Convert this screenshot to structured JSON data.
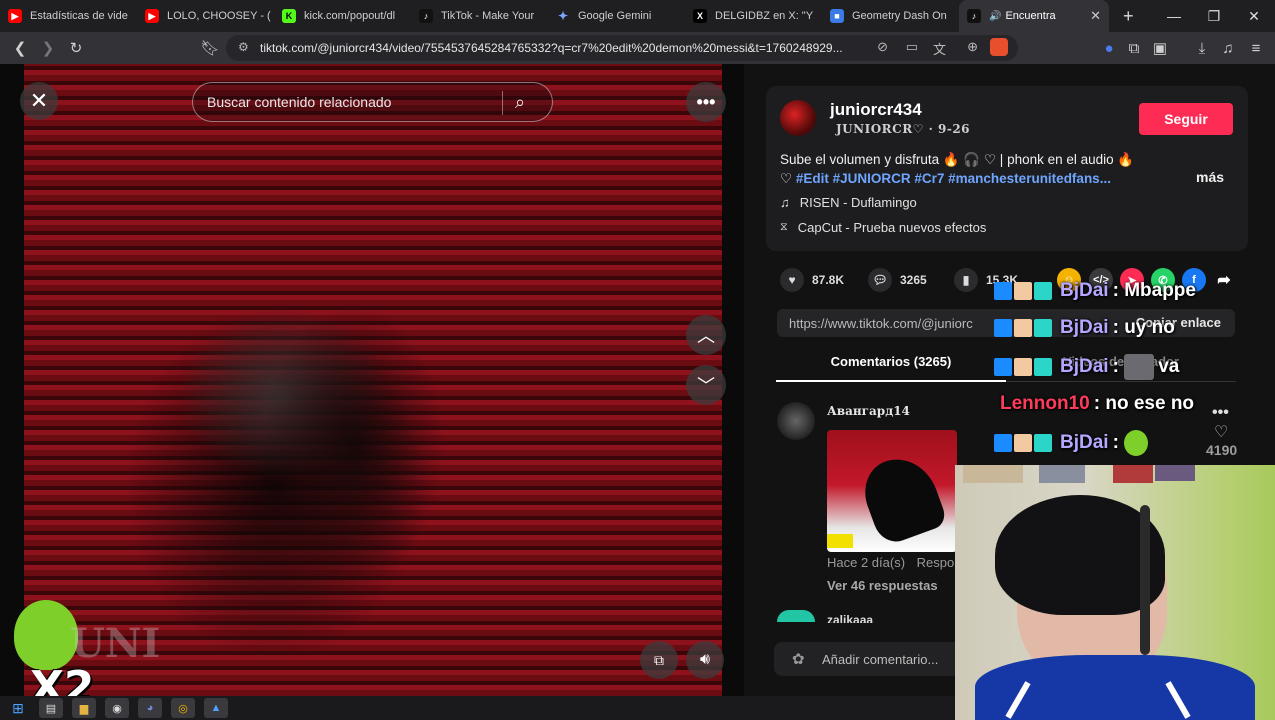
{
  "tabs": [
    {
      "title": "Estadísticas de vide",
      "color": "#ff0000",
      "glyph": "▶"
    },
    {
      "title": "LOLO, CHOOSEY - (",
      "color": "#ff0000",
      "glyph": "▶"
    },
    {
      "title": "kick.com/popout/dl",
      "color": "#53fc18",
      "glyph": "K"
    },
    {
      "title": "TikTok - Make Your",
      "color": "#111111",
      "glyph": "♪"
    },
    {
      "title": "Google Gemini",
      "color": "#4b7bec",
      "glyph": "✦"
    },
    {
      "title": "DELGIDBZ en X: \"Y",
      "color": "#000000",
      "glyph": "X"
    },
    {
      "title": "Geometry Dash On",
      "color": "#3b7be8",
      "glyph": "■"
    },
    {
      "title": "Encuentra",
      "color": "#111111",
      "glyph": "♪"
    }
  ],
  "toolbar": {
    "url": "tiktok.com/@juniorcr434/video/7554537645284765332?q=cr7%20edit%20demon%20messi&t=1760248929..."
  },
  "video": {
    "search_placeholder": "Buscar contenido relacionado",
    "x2_text": "X2",
    "watermark": "UNI"
  },
  "post": {
    "username": "juniorcr434",
    "nickname": "JUNIORCR♡",
    "date": "9-26",
    "follow_label": "Seguir",
    "caption": "Sube el volumen y disfruta 🔥 🎧 ♡ | phonk en el audio 🔥",
    "caption_prefix": "♡ ",
    "hashtags": "#Edit #JUNIORCR #Cr7 #manchesterunitedfans...",
    "more_label": "más",
    "music": "RISEN - Duflamingo",
    "effect": "CapCut - Prueba nuevos efectos"
  },
  "actions": {
    "likes": "87.8K",
    "comments": "3265",
    "saves": "15.3K"
  },
  "copy": {
    "link": "https://www.tiktok.com/@juniorc",
    "button": "Copiar enlace"
  },
  "comment_tabs": {
    "comments": "Comentarios (3265)",
    "creator": "Videos del creador"
  },
  "comment": {
    "author": "Авангард14",
    "time": "Hace 2 día(s)",
    "reply": "Responder",
    "view_replies": "Ver 46 respuestas",
    "like_count": "4190",
    "next_author": "zalikaaa"
  },
  "add_comment": "Añadir comentario...",
  "chat": [
    {
      "user": "BjDai",
      "msg": "Mbappe",
      "color": "#b6a6ff"
    },
    {
      "user": "BjDai",
      "msg": "uy no",
      "color": "#b6a6ff"
    },
    {
      "user": "BjDai",
      "msg": "va",
      "color": "#b6a6ff"
    },
    {
      "user": "Lennon10",
      "msg": "no ese no",
      "color": "#ff3b5c"
    },
    {
      "user": "BjDai",
      "msg": "",
      "color": "#b6a6ff"
    }
  ]
}
